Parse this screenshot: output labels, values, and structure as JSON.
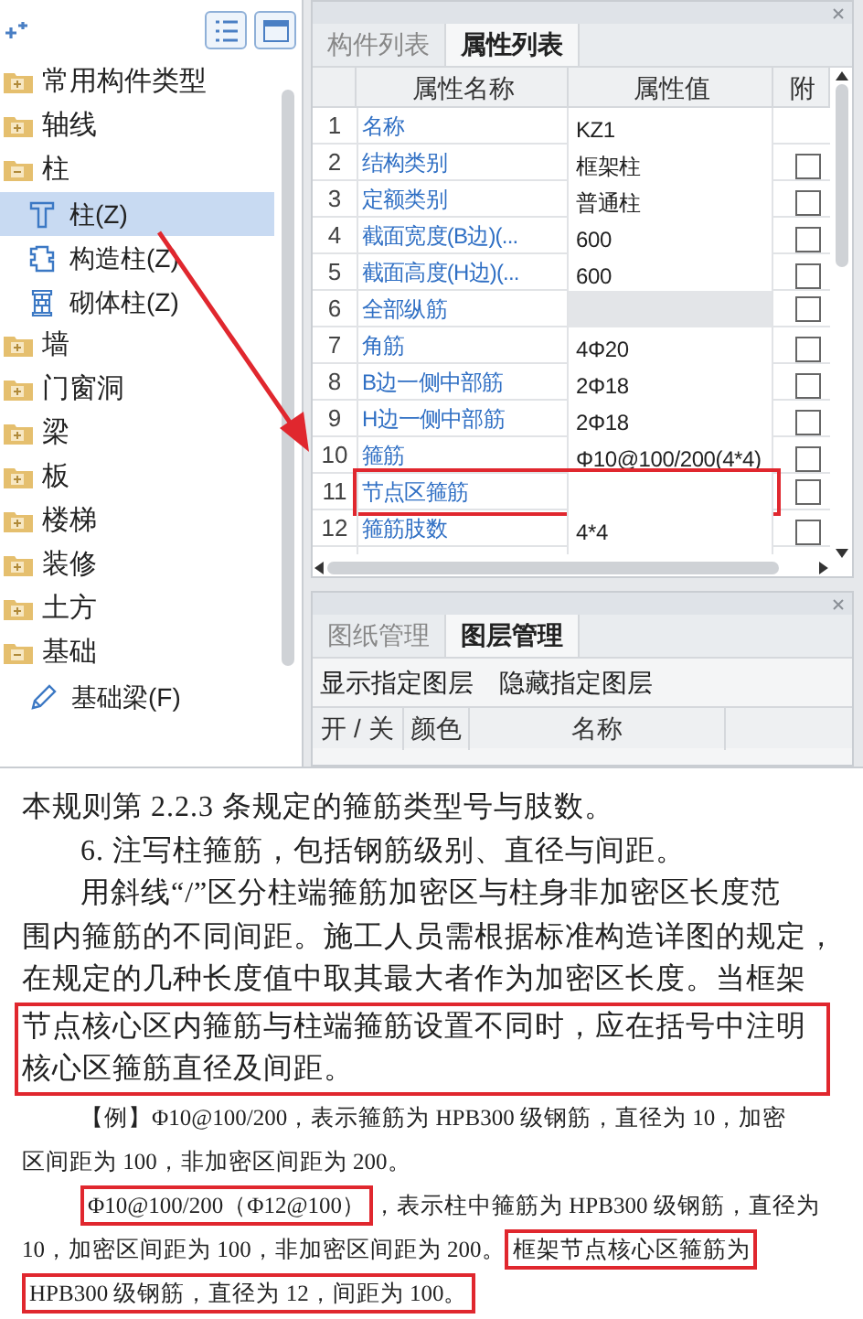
{
  "component_tree": {
    "items": [
      {
        "label": "常用构件类型",
        "expanded": false,
        "selected": false
      },
      {
        "label": "轴线",
        "expanded": false,
        "selected": false
      },
      {
        "label": "柱",
        "expanded": true,
        "selected": false,
        "children": [
          {
            "label": "柱(Z)",
            "kind": "column",
            "selected": true
          },
          {
            "label": "构造柱(Z)",
            "kind": "constructional_column",
            "selected": false
          },
          {
            "label": "砌体柱(Z)",
            "kind": "masonry_column",
            "selected": false
          }
        ]
      },
      {
        "label": "墙",
        "expanded": false,
        "selected": false
      },
      {
        "label": "门窗洞",
        "expanded": false,
        "selected": false
      },
      {
        "label": "梁",
        "expanded": false,
        "selected": false
      },
      {
        "label": "板",
        "expanded": false,
        "selected": false
      },
      {
        "label": "楼梯",
        "expanded": false,
        "selected": false
      },
      {
        "label": "装修",
        "expanded": false,
        "selected": false
      },
      {
        "label": "土方",
        "expanded": false,
        "selected": false
      },
      {
        "label": "基础",
        "expanded": true,
        "selected": false,
        "children": [
          {
            "label": "基础梁(F)",
            "kind": "foundation_beam",
            "selected": false
          }
        ]
      }
    ]
  },
  "properties_panel": {
    "tabs": [
      {
        "label": "构件列表",
        "selected": false
      },
      {
        "label": "属性列表",
        "selected": true
      }
    ],
    "columns": [
      "属性名称",
      "属性值",
      "附"
    ],
    "rows": [
      {
        "number": "1",
        "name": "名称",
        "value": "KZ1",
        "group": false,
        "highlighted": false
      },
      {
        "number": "2",
        "name": "结构类别",
        "value": "框架柱",
        "group": false,
        "highlighted": false,
        "checked": false
      },
      {
        "number": "3",
        "name": "定额类别",
        "value": "普通柱",
        "group": false,
        "highlighted": false,
        "checked": false
      },
      {
        "number": "4",
        "name": "截面宽度(B边)(...",
        "value": "600",
        "group": false,
        "highlighted": false,
        "checked": false
      },
      {
        "number": "5",
        "name": "截面高度(H边)(...",
        "value": "600",
        "group": false,
        "highlighted": false,
        "checked": false
      },
      {
        "number": "6",
        "name": "全部纵筋",
        "value": "",
        "group": true,
        "highlighted": false,
        "checked": false
      },
      {
        "number": "7",
        "name": "角筋",
        "value": "4Φ20",
        "group": false,
        "highlighted": false,
        "checked": false
      },
      {
        "number": "8",
        "name": "B边一侧中部筋",
        "value": "2Φ18",
        "group": false,
        "highlighted": false,
        "checked": false
      },
      {
        "number": "9",
        "name": "H边一侧中部筋",
        "value": "2Φ18",
        "group": false,
        "highlighted": false,
        "checked": false
      },
      {
        "number": "10",
        "name": "箍筋",
        "value": "Φ10@100/200(4*4)",
        "group": false,
        "highlighted": false,
        "checked": false
      },
      {
        "number": "11",
        "name": "节点区箍筋",
        "value": "",
        "group": false,
        "highlighted": true,
        "checked": false
      },
      {
        "number": "12",
        "name": "箍筋肢数",
        "value": "4*4",
        "group": false,
        "highlighted": false,
        "checked": false
      }
    ]
  },
  "layers_panel": {
    "tabs": [
      {
        "label": "图纸管理",
        "selected": false
      },
      {
        "label": "图层管理",
        "selected": true
      }
    ],
    "buttons": [
      "显示指定图层",
      "隐藏指定图层"
    ],
    "columns": [
      "开 / 关",
      "颜色",
      "名称"
    ]
  },
  "book_page": {
    "blocks": [
      {
        "kind": "line",
        "segments": [
          {
            "text": "本规则第 2.2.3 条规定的箍筋类型号与肢数。",
            "boxed": false
          }
        ]
      },
      {
        "kind": "indented_line",
        "segments": [
          {
            "text": "6. 注写柱箍筋，包括钢筋级别、直径与间距。",
            "boxed": false
          }
        ]
      },
      {
        "kind": "indented_line",
        "segments": [
          {
            "text": "用斜线“/”区分柱端箍筋加密区与柱身非加密区长度范",
            "boxed": false
          }
        ]
      },
      {
        "kind": "line",
        "segments": [
          {
            "text": "围内箍筋的不同间距。施工人员需根据标准构造详图的规定，",
            "boxed": false
          }
        ]
      },
      {
        "kind": "line",
        "segments": [
          {
            "text": "在规定的几种长度值中取其最大者作为加密区长度。当框架",
            "boxed": false
          }
        ]
      },
      {
        "kind": "boxed_block",
        "lines": [
          "节点核心区内箍筋与柱端箍筋设置不同时，应在括号中注明",
          "核心区箍筋直径及间距。"
        ]
      },
      {
        "kind": "indented_example_line",
        "segments": [
          {
            "text": "【例】Φ10@100/200，表示箍筋为 HPB300 级钢筋，直径为 10，加密",
            "boxed": false
          }
        ]
      },
      {
        "kind": "example_line",
        "segments": [
          {
            "text": "区间距为 100，非加密区间距为 200。",
            "boxed": false
          }
        ]
      },
      {
        "kind": "indented_example_line",
        "segments": [
          {
            "text": "Φ10@100/200（Φ12@100）",
            "boxed": true
          },
          {
            "text": "，表示柱中箍筋为 HPB300 级钢筋，直径为",
            "boxed": false
          }
        ]
      },
      {
        "kind": "example_line",
        "segments": [
          {
            "text": "10，加密区间距为 100，非加密区间距为 200。",
            "boxed": false
          },
          {
            "text": "框架节点核心区箍筋为",
            "boxed": true
          }
        ]
      },
      {
        "kind": "example_line",
        "segments": [
          {
            "text": "HPB300 级钢筋，直径为 12，间距为 100。",
            "boxed": true
          }
        ]
      }
    ]
  }
}
